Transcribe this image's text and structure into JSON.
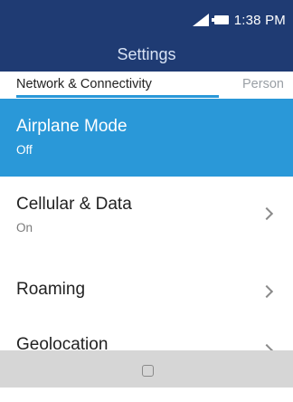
{
  "status_bar": {
    "time": "1:38 PM",
    "icons": [
      "signal-icon",
      "battery-icon"
    ]
  },
  "header": {
    "title": "Settings"
  },
  "tabs": [
    {
      "label": "Network & Connectivity",
      "active": true
    },
    {
      "label": "Person",
      "active": false
    }
  ],
  "list": [
    {
      "title": "Airplane Mode",
      "subtitle": "Off",
      "selected": true,
      "chevron": false
    },
    {
      "title": "Cellular & Data",
      "subtitle": "On",
      "selected": false,
      "chevron": true
    },
    {
      "title": "Roaming",
      "subtitle": "",
      "selected": false,
      "chevron": true
    },
    {
      "title": "Geolocation",
      "subtitle": "",
      "selected": false,
      "chevron": true
    }
  ],
  "navbar": {
    "icons": [
      "home-icon"
    ]
  },
  "colors": {
    "header_bg": "#1f3b73",
    "accent": "#2a98d8",
    "navbar_bg": "#d6d6d6"
  }
}
